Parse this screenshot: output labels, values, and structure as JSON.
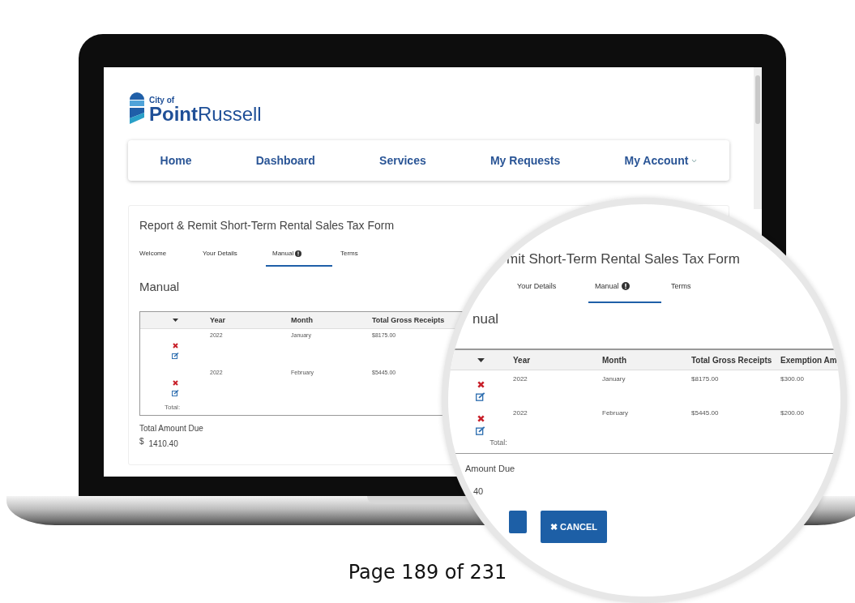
{
  "logo": {
    "small": "City of",
    "bold": "Point",
    "light": "Russell"
  },
  "nav": [
    {
      "label": "Home",
      "kind": "link"
    },
    {
      "label": "Dashboard",
      "kind": "link"
    },
    {
      "label": "Services",
      "kind": "link"
    },
    {
      "label": "My Requests",
      "kind": "link"
    },
    {
      "label": "My Account",
      "kind": "menu"
    }
  ],
  "form": {
    "title": "Report & Remit Short-Term Rental Sales Tax Form",
    "tabs": [
      {
        "label": "Welcome",
        "selected": false,
        "info": false
      },
      {
        "label": "Your Details",
        "selected": false,
        "info": false
      },
      {
        "label": "Manual",
        "selected": true,
        "info": true
      },
      {
        "label": "Terms",
        "selected": false,
        "info": false
      }
    ],
    "section": "Manual",
    "columns": [
      "Year",
      "Month",
      "Total Gross Receipts"
    ],
    "rows": [
      {
        "cells": [
          "2022",
          "January",
          "$8175.00"
        ]
      },
      {
        "cells": [
          "2022",
          "February",
          "$5445.00"
        ]
      }
    ],
    "total_label": "Total:",
    "amount_label": "Total Amount Due",
    "currency": "$",
    "amount": "1410.40"
  },
  "magnifier": {
    "title": "mit Short-Term Rental Sales Tax Form",
    "tabs": [
      {
        "label": "Your Details",
        "selected": false,
        "info": false
      },
      {
        "label": "Manual",
        "selected": true,
        "info": true
      },
      {
        "label": "Terms",
        "selected": false,
        "info": false
      }
    ],
    "section": "nual",
    "columns": [
      "Year",
      "Month",
      "Total Gross Receipts",
      "Exemption Am"
    ],
    "rows": [
      {
        "cells": [
          "2022",
          "January",
          "$8175.00",
          "$300.00"
        ]
      },
      {
        "cells": [
          "2022",
          "February",
          "$5445.00",
          "$200.00"
        ]
      }
    ],
    "total_label": "Total:",
    "amount_label": "Amount Due",
    "amount": "40",
    "buttons": [
      {
        "kind": "primary"
      },
      {
        "kind": "cancel",
        "icon": "✖",
        "label": "CANCEL"
      }
    ]
  },
  "footer": "Page 189 of 231"
}
